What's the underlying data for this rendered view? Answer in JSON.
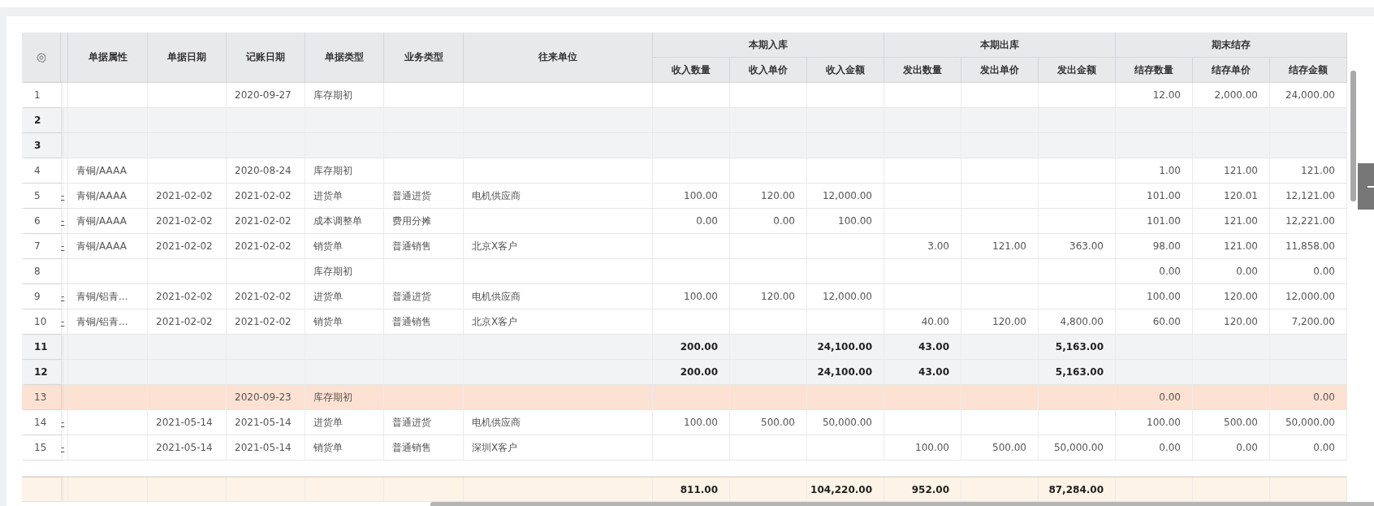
{
  "table": {
    "header": {
      "columns": [
        "单据属性",
        "单据日期",
        "记账日期",
        "单据类型",
        "业务类型",
        "往来单位"
      ],
      "groups": [
        {
          "label": "本期入库",
          "columns": [
            "收入数量",
            "收入单价",
            "收入金额"
          ]
        },
        {
          "label": "本期出库",
          "columns": [
            "发出数量",
            "发出单价",
            "发出金额"
          ]
        },
        {
          "label": "期末结存",
          "columns": [
            "结存数量",
            "结存单价",
            "结存金额"
          ]
        }
      ]
    },
    "rows": [
      {
        "index": "1",
        "kind": "normal",
        "cells": [
          null,
          null,
          null,
          "2020-09-27",
          "库存期初",
          null,
          null,
          null,
          null,
          null,
          null,
          null,
          null,
          "12.00",
          "2,000.00",
          "24,000.00"
        ]
      },
      {
        "index": "2",
        "kind": "subtotal",
        "cells": [
          null,
          null,
          null,
          null,
          null,
          null,
          null,
          null,
          null,
          null,
          null,
          null,
          null,
          null,
          null,
          null
        ]
      },
      {
        "index": "3",
        "kind": "subtotal",
        "cells": [
          null,
          null,
          null,
          null,
          null,
          null,
          null,
          null,
          null,
          null,
          null,
          null,
          null,
          null,
          null,
          null
        ]
      },
      {
        "index": "4",
        "kind": "normal",
        "cells": [
          null,
          "青铜/AAAA",
          null,
          "2020-08-24",
          "库存期初",
          null,
          null,
          null,
          null,
          null,
          null,
          null,
          null,
          "1.00",
          "121.00",
          "121.00"
        ]
      },
      {
        "index": "5",
        "kind": "normal",
        "cells": [
          "-",
          "青铜/AAAA",
          "2021-02-02",
          "2021-02-02",
          "进货单",
          "普通进货",
          "电机供应商",
          "100.00",
          "120.00",
          "12,000.00",
          null,
          null,
          null,
          "101.00",
          "120.01",
          "12,121.00"
        ]
      },
      {
        "index": "6",
        "kind": "normal",
        "cells": [
          "-",
          "青铜/AAAA",
          "2021-02-02",
          "2021-02-02",
          "成本调整单",
          "费用分摊",
          null,
          "0.00",
          "0.00",
          "100.00",
          null,
          null,
          null,
          "101.00",
          "121.00",
          "12,221.00"
        ]
      },
      {
        "index": "7",
        "kind": "normal",
        "cells": [
          "-",
          "青铜/AAAA",
          "2021-02-02",
          "2021-02-02",
          "销货单",
          "普通销售",
          "北京X客户",
          null,
          null,
          null,
          "3.00",
          "121.00",
          "363.00",
          "98.00",
          "121.00",
          "11,858.00"
        ]
      },
      {
        "index": "8",
        "kind": "normal",
        "cells": [
          null,
          null,
          null,
          null,
          "库存期初",
          null,
          null,
          null,
          null,
          null,
          null,
          null,
          null,
          "0.00",
          "0.00",
          "0.00"
        ]
      },
      {
        "index": "9",
        "kind": "normal",
        "cells": [
          "-",
          "青铜/铝青...",
          "2021-02-02",
          "2021-02-02",
          "进货单",
          "普通进货",
          "电机供应商",
          "100.00",
          "120.00",
          "12,000.00",
          null,
          null,
          null,
          "100.00",
          "120.00",
          "12,000.00"
        ]
      },
      {
        "index": "10",
        "kind": "normal",
        "cells": [
          "-",
          "青铜/铝青...",
          "2021-02-02",
          "2021-02-02",
          "销货单",
          "普通销售",
          "北京X客户",
          null,
          null,
          null,
          "40.00",
          "120.00",
          "4,800.00",
          "60.00",
          "120.00",
          "7,200.00"
        ]
      },
      {
        "index": "11",
        "kind": "subtotal",
        "cells": [
          null,
          null,
          null,
          null,
          null,
          null,
          null,
          "200.00",
          null,
          "24,100.00",
          "43.00",
          null,
          "5,163.00",
          null,
          null,
          null
        ]
      },
      {
        "index": "12",
        "kind": "subtotal",
        "cells": [
          null,
          null,
          null,
          null,
          null,
          null,
          null,
          "200.00",
          null,
          "24,100.00",
          "43.00",
          null,
          "5,163.00",
          null,
          null,
          null
        ]
      },
      {
        "index": "13",
        "kind": "highlight",
        "cells": [
          null,
          null,
          null,
          "2020-09-23",
          "库存期初",
          null,
          null,
          null,
          null,
          null,
          null,
          null,
          null,
          "0.00",
          null,
          "0.00"
        ]
      },
      {
        "index": "14",
        "kind": "normal",
        "cells": [
          "-",
          null,
          "2021-05-14",
          "2021-05-14",
          "进货单",
          "普通进货",
          "电机供应商",
          "100.00",
          "500.00",
          "50,000.00",
          null,
          null,
          null,
          "100.00",
          "500.00",
          "50,000.00"
        ]
      },
      {
        "index": "15",
        "kind": "normal",
        "cells": [
          "-",
          null,
          "2021-05-14",
          "2021-05-14",
          "销货单",
          "普通销售",
          "深圳X客户",
          null,
          null,
          null,
          "100.00",
          "500.00",
          "50,000.00",
          "0.00",
          "0.00",
          "0.00"
        ]
      }
    ],
    "footer": {
      "cells": [
        null,
        null,
        null,
        null,
        null,
        null,
        null,
        "811.00",
        null,
        "104,220.00",
        "952.00",
        null,
        "87,284.00",
        null,
        null,
        null
      ]
    }
  }
}
